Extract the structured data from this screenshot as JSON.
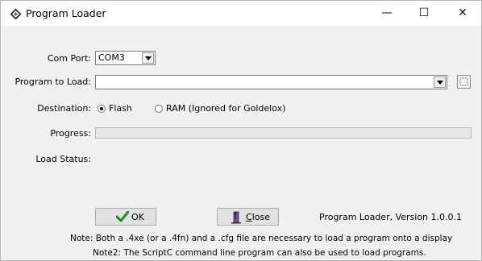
{
  "window": {
    "title": "Program Loader",
    "controls": {
      "minimize": "—",
      "maximize": "☐",
      "close": "✕"
    }
  },
  "form": {
    "com_port_label": "Com Port:",
    "com_port_value": "COM3",
    "program_label": "Program to Load:",
    "program_value": "",
    "destination_label": "Destination:",
    "destination_options": [
      {
        "label": "Flash",
        "selected": true
      },
      {
        "label": "RAM (Ignored for Goldelox)",
        "selected": false
      }
    ],
    "progress_label": "Progress:",
    "progress_fraction": 0,
    "load_status_label": "Load Status:",
    "load_status_value": ""
  },
  "buttons": {
    "ok_label": "OK",
    "close_label_prefix": "",
    "close_label_accel": "C",
    "close_label_rest": "lose"
  },
  "version_text": "Program Loader, Version 1.0.0.1",
  "notes": {
    "note1": "Note: Both a .4xe (or a .4fn) and a .cfg file are necessary to load a program onto a display",
    "note2": "Note2: The ScriptC command line program can also be used to load programs."
  },
  "icons": {
    "app": "4d-diamond-icon",
    "browse": "browse-icon",
    "ok": "checkmark-icon",
    "close": "close-door-icon"
  },
  "colors": {
    "ok_check": "#1a8f1a",
    "titlebar_bg": "#ffffff",
    "window_bg": "#f0f0f0"
  }
}
